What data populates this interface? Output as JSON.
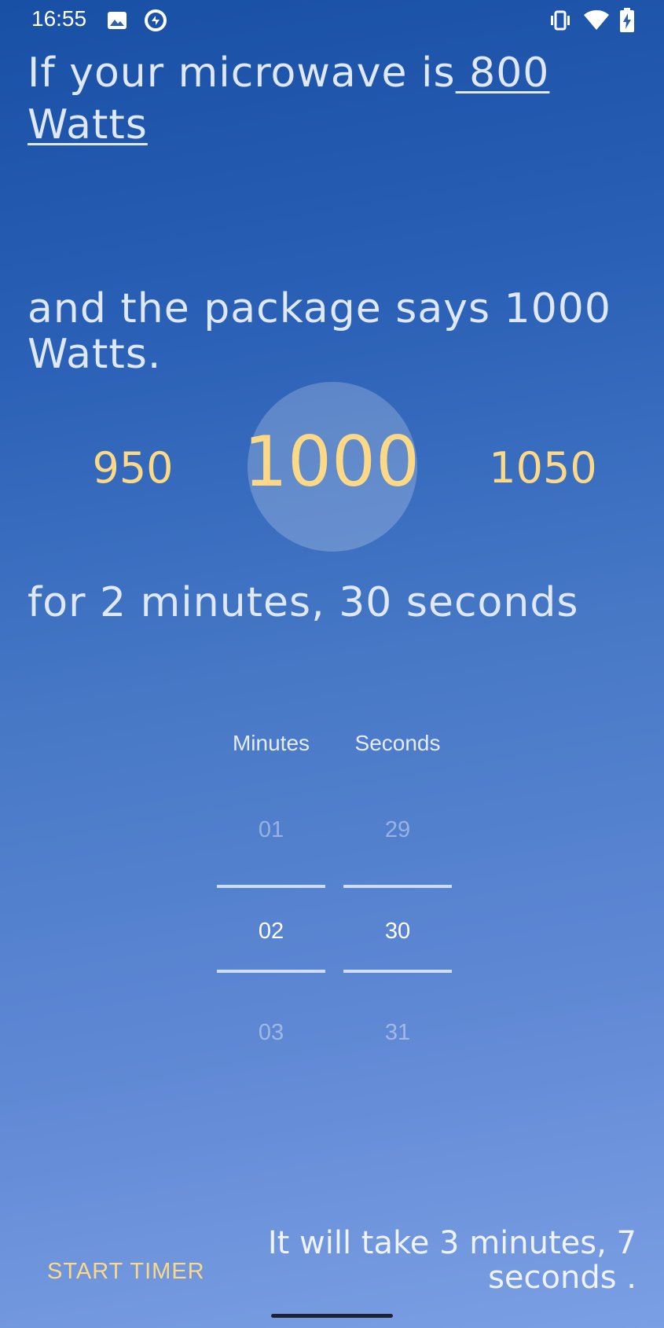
{
  "status_bar": {
    "time": "16:55",
    "icons": [
      "image-icon",
      "data-saver-icon",
      "vibrate-icon",
      "wifi-icon",
      "battery-charging-icon"
    ]
  },
  "headline": {
    "prefix": "If your microwave is",
    "power_link": " 800 Watts"
  },
  "package": {
    "text": "and the package says 1000 Watts."
  },
  "wattage_picker": {
    "previous": "950",
    "selected": "1000",
    "next": "1050"
  },
  "duration": {
    "text": "for 2 minutes, 30 seconds"
  },
  "time_picker": {
    "minutes": {
      "header": "Minutes",
      "above": "01",
      "selected": "02",
      "below": "03"
    },
    "seconds": {
      "header": "Seconds",
      "above": "29",
      "selected": "30",
      "below": "31"
    }
  },
  "footer": {
    "start_timer_label": "START TIMER",
    "result": "It will take 3 minutes, 7 seconds ."
  },
  "colors": {
    "accent": "#fcd987",
    "background_top": "#1850a6",
    "background_bottom": "#7b9fe4"
  }
}
